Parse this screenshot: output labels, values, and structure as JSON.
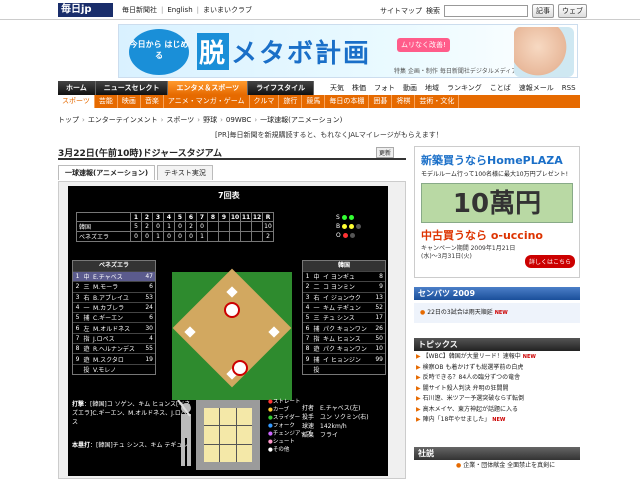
{
  "top": {
    "logo": "毎日jp",
    "links": [
      "毎日新聞社",
      "English",
      "まいまいクラブ"
    ],
    "sitemap": "サイトマップ",
    "search_label": "検索",
    "search_placeholder": "",
    "btn_article": "記事",
    "btn_web": "ウェブ"
  },
  "banner": {
    "circle": "今日から はじめる",
    "title_box": "脱",
    "title_rest": "メタボ計画",
    "badge": "ムリなく改善!",
    "credit": "特集 企画・制作 毎日新聞社デジタルメディア局"
  },
  "nav1": {
    "items": [
      "ホーム",
      "ニュースセレクト",
      "エンタメ＆スポーツ",
      "ライフスタイル"
    ],
    "active_index": 2,
    "right": [
      "天気",
      "株価",
      "フォト",
      "動画",
      "地域",
      "ランキング",
      "ことば",
      "速報メール",
      "RSS"
    ]
  },
  "nav2": {
    "items": [
      "スポーツ",
      "芸能",
      "映画",
      "音楽",
      "アニメ・マンガ・ゲーム",
      "クルマ",
      "旅行",
      "競馬",
      "毎日の本棚",
      "囲碁",
      "将棋",
      "芸術・文化"
    ],
    "active_index": 0
  },
  "breadcrumb": [
    "トップ",
    "エンターテインメント",
    "スポーツ",
    "野球",
    "09WBC",
    "一球速報(アニメーション)"
  ],
  "promo": "[PR]毎日新聞を新規購読すると、もれなくJALマイレージがもらえます！",
  "article": {
    "title": "3月22日(午前10時)ドジャースタジアム",
    "refresh": "更新",
    "tabs": [
      "一球速報(アニメーション)",
      "テキスト実況"
    ],
    "active_tab": 0
  },
  "board": {
    "inning": "7回表",
    "innings": [
      "1",
      "2",
      "3",
      "4",
      "5",
      "6",
      "7",
      "8",
      "9",
      "10",
      "11",
      "12",
      "R"
    ],
    "teams": [
      {
        "name": "韓国",
        "scores": [
          "5",
          "2",
          "0",
          "1",
          "0",
          "2",
          "0",
          "",
          "",
          "",
          "",
          "",
          "10"
        ]
      },
      {
        "name": "ベネズエラ",
        "scores": [
          "0",
          "0",
          "1",
          "0",
          "0",
          "0",
          "1",
          "",
          "",
          "",
          "",
          "",
          "2"
        ]
      }
    ],
    "bso": [
      {
        "label": "S",
        "dots": [
          "g",
          "g"
        ]
      },
      {
        "label": "B",
        "dots": [
          "y",
          "y",
          "y"
        ]
      },
      {
        "label": "O",
        "dots": [
          "r",
          "r"
        ]
      }
    ],
    "home_lineup": {
      "title": "ベネズエラ",
      "rows": [
        {
          "n": "1",
          "p": "中",
          "name": "E.チャベス",
          "num": "47",
          "hl": true
        },
        {
          "n": "2",
          "p": "三",
          "name": "M.モーラ",
          "num": "6",
          "hl": false
        },
        {
          "n": "3",
          "p": "右",
          "name": "B.アブレイユ",
          "num": "53",
          "hl": false
        },
        {
          "n": "4",
          "p": "一",
          "name": "M.カブレラ",
          "num": "24",
          "hl": false
        },
        {
          "n": "5",
          "p": "捕",
          "name": "C.ギーエン",
          "num": "6",
          "hl": false
        },
        {
          "n": "6",
          "p": "左",
          "name": "M.オルドネス",
          "num": "30",
          "hl": false
        },
        {
          "n": "7",
          "p": "指",
          "name": "J.ロペス",
          "num": "4",
          "hl": false
        },
        {
          "n": "8",
          "p": "遊",
          "name": "R.ヘルナンデス",
          "num": "55",
          "hl": false
        },
        {
          "n": "9",
          "p": "遊",
          "name": "M.スクタロ",
          "num": "19",
          "hl": false
        },
        {
          "n": "",
          "p": "投",
          "name": "V.モレノ",
          "num": "",
          "hl": false
        }
      ]
    },
    "away_lineup": {
      "title": "韓国",
      "rows": [
        {
          "n": "1",
          "p": "中",
          "name": "イ ヨンギュ",
          "num": "8",
          "hl": false
        },
        {
          "n": "2",
          "p": "二",
          "name": "コ ヨンミン",
          "num": "9",
          "hl": false
        },
        {
          "n": "3",
          "p": "右",
          "name": "イ ジョンウク",
          "num": "13",
          "hl": false
        },
        {
          "n": "4",
          "p": "一",
          "name": "キム テギュン",
          "num": "52",
          "hl": false
        },
        {
          "n": "5",
          "p": "三",
          "name": "チュ シンス",
          "num": "17",
          "hl": false
        },
        {
          "n": "6",
          "p": "捕",
          "name": "パク キョンワン",
          "num": "26",
          "hl": false
        },
        {
          "n": "7",
          "p": "指",
          "name": "キム ヒョンス",
          "num": "50",
          "hl": false
        },
        {
          "n": "8",
          "p": "遊",
          "name": "パク キョンワン",
          "num": "10",
          "hl": false
        },
        {
          "n": "9",
          "p": "捕",
          "name": "イ ヒョンジン",
          "num": "99",
          "hl": false
        },
        {
          "n": "",
          "p": "投",
          "name": "",
          "num": "",
          "hl": false
        }
      ]
    },
    "stats": {
      "batting_label": "打撃",
      "batting_text": "[韓国]コ ソゲン、キム ヒョンス[ベネズエラ]C.ギーエン、M.オルドネス、J.ロペス",
      "hr_label": "本塁打",
      "hr_text": "[韓国]チュ シンス、キム テギュン"
    },
    "legend": [
      "ストレート",
      "カーブ",
      "スライダー",
      "フォーク",
      "チェンジアップ",
      "シュート",
      "その他"
    ],
    "pitch_info": {
      "labels": [
        "打者",
        "投手",
        "球速",
        "結果"
      ],
      "values": [
        "E.チャベス(左)",
        "ユン ソクミン(右)",
        "142km/h",
        "フライ"
      ]
    }
  },
  "right": {
    "ad": {
      "title": "新築買うならHomePLAZA",
      "sub": "モデルルーム行って100名様に最大10万円プレゼント!",
      "bill": "10萬円",
      "brand": "中古買うなら o-uccino",
      "campaign": "キャンペーン期間 2009年1月21日(水)～3月31日(火)",
      "button": "詳しくはこちら"
    },
    "senbatsu": {
      "title": "センバツ 2009",
      "body": "22日の3試合は雨天順延"
    },
    "topics": {
      "title": "トピックス",
      "items": [
        "【WBC】韓国が大量リード！速報中",
        "検察OB も着かけずも総選挙前の白虎",
        "反時できる？84人の臨分ずつの竜舎",
        "闇サイト殺人判決 弁明の狂間開",
        "石川遼、米ツアー予選突破ならず転倒",
        "高木メイヤ、東方神起が話題に入る",
        "陣内「18年やせました」"
      ]
    },
    "social": {
      "title": "社説",
      "body": "企業・団体献金 全面禁止を真剣に"
    }
  }
}
